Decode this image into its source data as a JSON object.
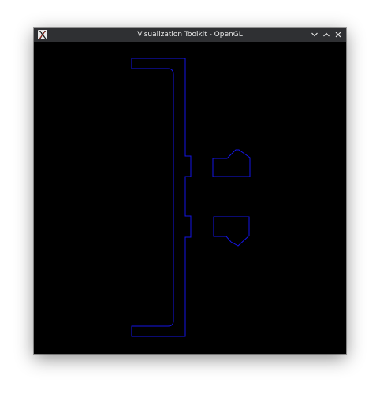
{
  "window": {
    "title": "Visualization Toolkit - OpenGL",
    "app_icon": "x11-icon",
    "controls": {
      "minimize_icon": "chevron-down-icon",
      "maximize_icon": "chevron-up-icon",
      "close_icon": "close-icon"
    }
  },
  "colors": {
    "titlebar": "#2f3033",
    "title_text": "#eaeaea",
    "viewport_background": "#000000",
    "outline": "#1515e6"
  }
}
